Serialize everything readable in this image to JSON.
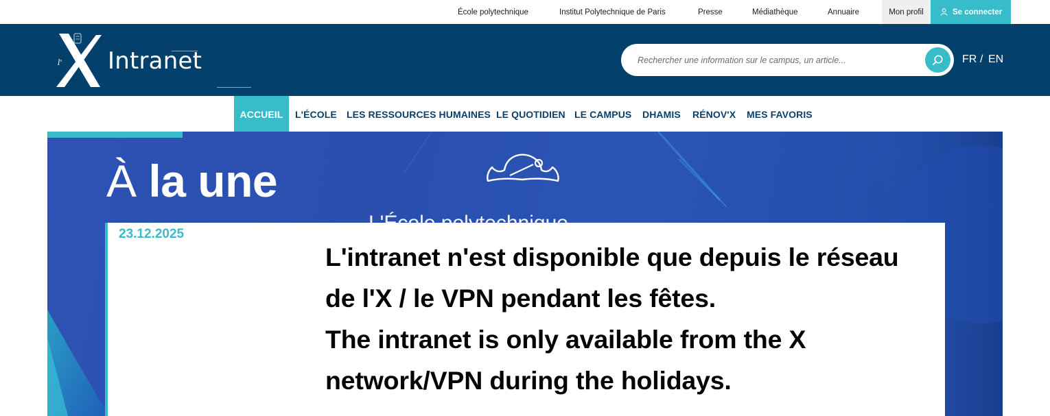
{
  "topbar": {
    "links": [
      "École polytechnique",
      "Institut Polytechnique de Paris",
      "Presse",
      "Médiathèque",
      "Annuaire"
    ],
    "profile_label": "Mon profil",
    "login_label": "Se connecter",
    "login_icon": "user-icon"
  },
  "header": {
    "logo_word": "Intranet",
    "search_placeholder": "Rechercher une information sur le campus, un article...",
    "search_icon": "search-icon",
    "lang_fr": "FR",
    "lang_separator": "/",
    "lang_en": "EN"
  },
  "nav": {
    "items": [
      "ACCUEIL",
      "L'ÉCOLE",
      "LES RESSOURCES HUMAINES",
      "LE QUOTIDIEN",
      "LE CAMPUS",
      "DHAMIS",
      "RÉNOV'X",
      "MES FAVORIS"
    ],
    "active": "ACCUEIL"
  },
  "hero": {
    "title_light": "À",
    "title_bold": "la une",
    "background_text": "L'École polytechnique",
    "illustration": "bicorne-hat-icon"
  },
  "article": {
    "date": "23.12.2025",
    "headline_lines": [
      "L'intranet n'est disponible que depuis le réseau",
      "de l'X / le VPN pendant les fêtes.",
      "The intranet is only available from the X",
      "network/VPN during the holidays."
    ]
  },
  "colors": {
    "header_bg": "#03406b",
    "accent_teal": "#38bcc9",
    "nav_text": "#0b3f6b",
    "hero_blue": "#2b52b3"
  }
}
